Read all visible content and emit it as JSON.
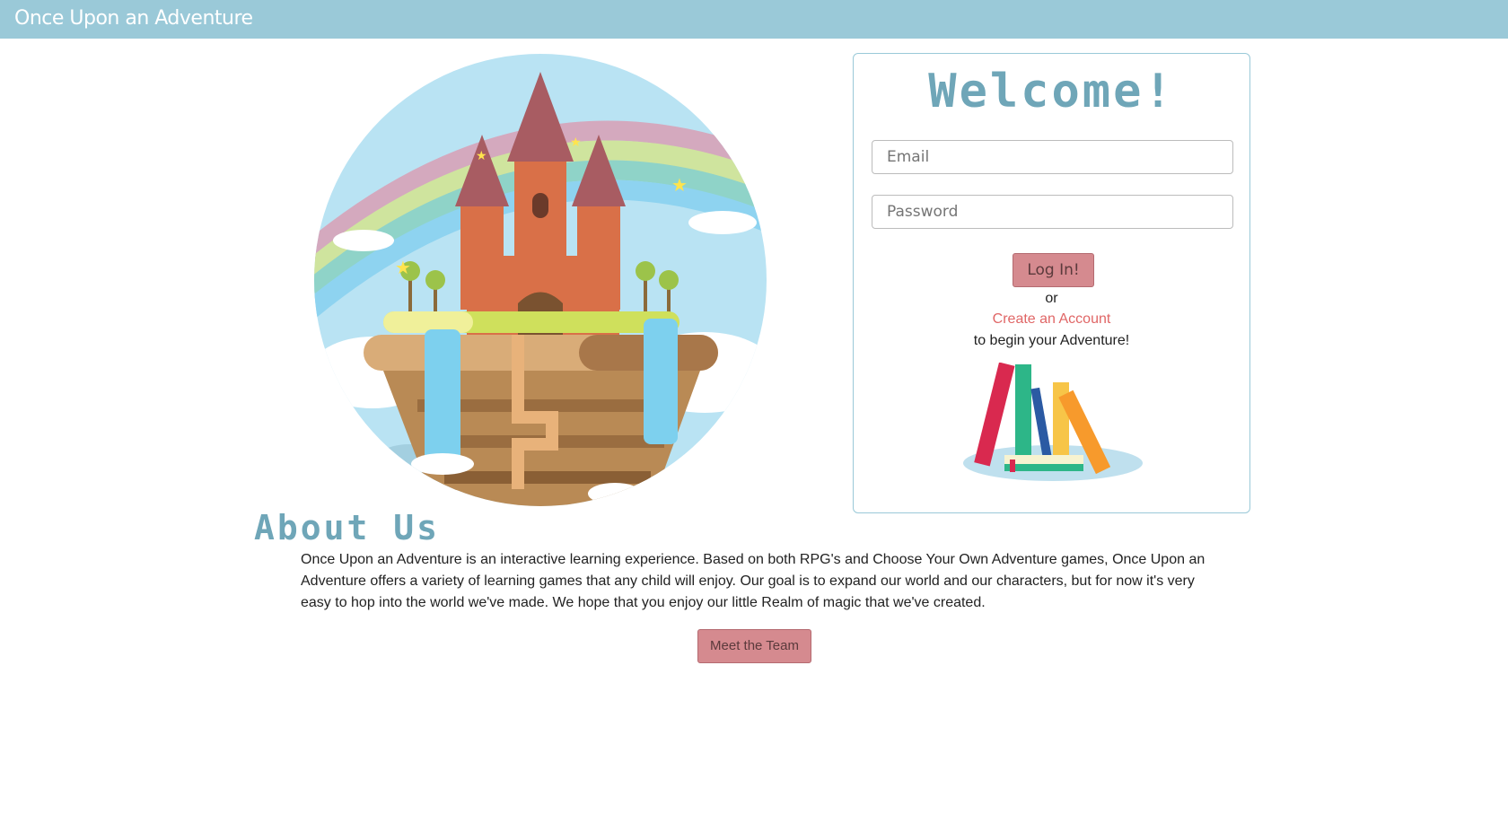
{
  "navbar": {
    "brand": "Once Upon an Adventure"
  },
  "login": {
    "title": "Welcome!",
    "email_placeholder": "Email",
    "password_placeholder": "Password",
    "login_label": "Log In!",
    "or_text": "or",
    "create_account_label": "Create an Account",
    "begin_text": "to begin your Adventure!"
  },
  "about": {
    "title": "About Us",
    "body": "Once Upon an Adventure is an interactive learning experience. Based on both RPG's and Choose Your Own Adventure games, Once Upon an Adventure offers a variety of learning games that any child will enjoy. Our goal is to expand our world and our characters, but for now it's very easy to hop into the world we've made. We hope that you enjoy our little Realm of magic that we've created.",
    "team_button": "Meet the Team"
  },
  "colors": {
    "navbar": "#9ac9d8",
    "heading": "#6fa6b8",
    "button": "#d58a8f",
    "link": "#e06666"
  },
  "icons": {
    "hero": "castle-illustration",
    "books": "books-illustration"
  }
}
